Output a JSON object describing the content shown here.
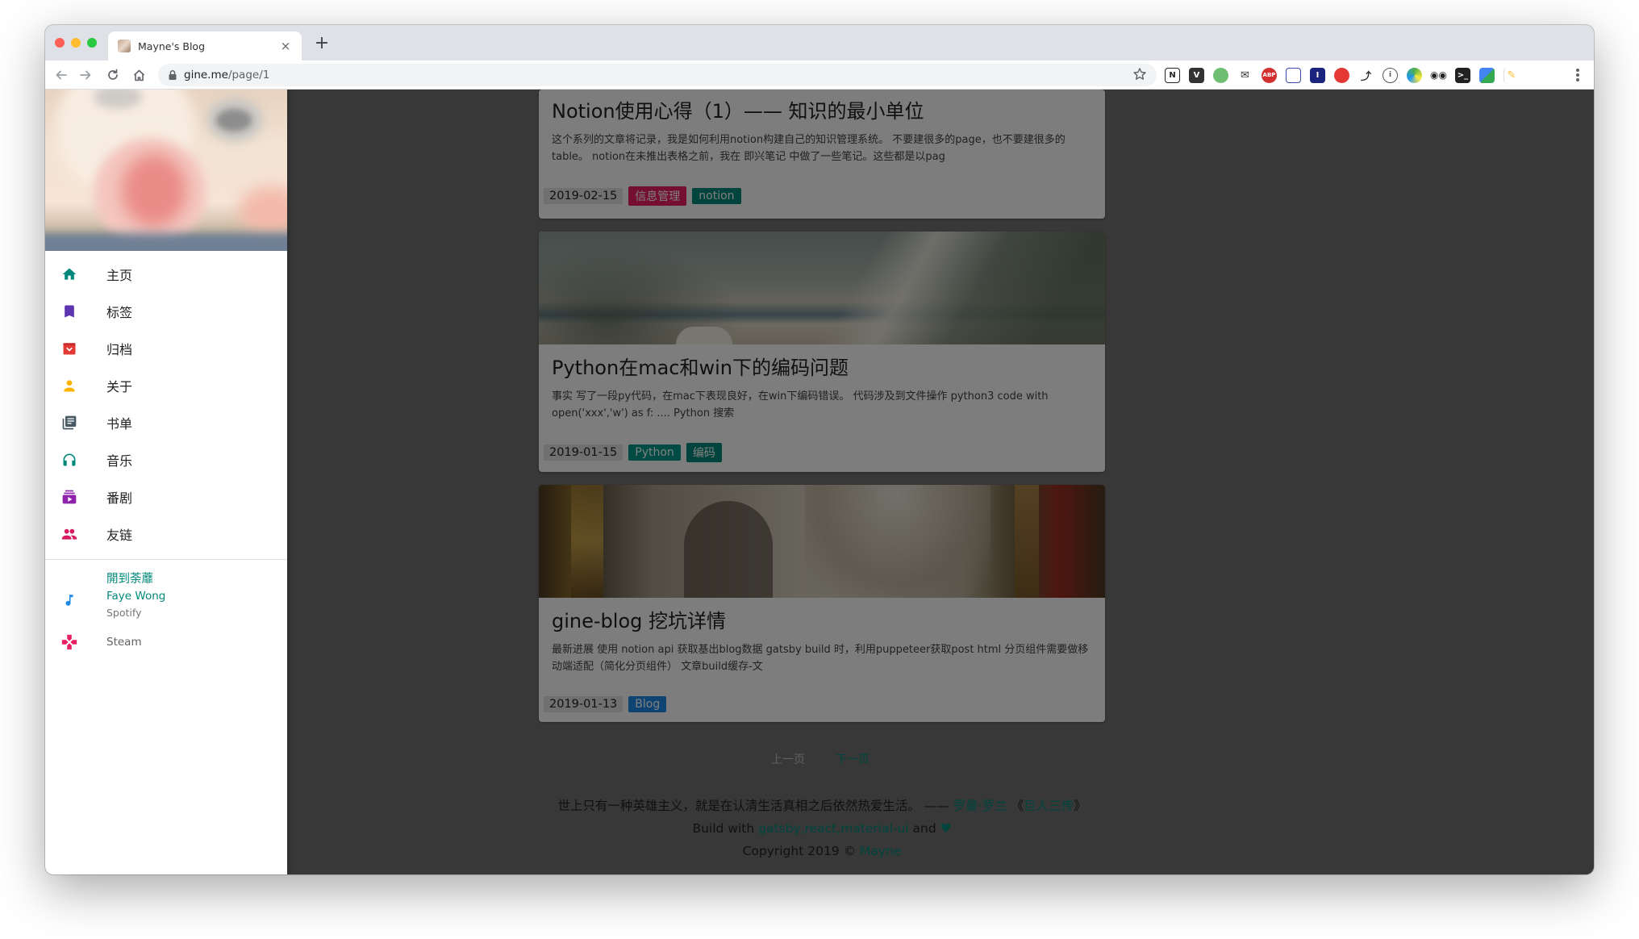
{
  "browser": {
    "tab_title": "Mayne's Blog",
    "tab_close": "×",
    "new_tab": "+",
    "url_host": "gine.me",
    "url_path": "/page/1"
  },
  "sidebar": {
    "items": [
      {
        "label": "主页",
        "icon": "home-icon",
        "color": "#00897b"
      },
      {
        "label": "标签",
        "icon": "bookmark-icon",
        "color": "#5e35b1"
      },
      {
        "label": "归档",
        "icon": "archive-icon",
        "color": "#e53935"
      },
      {
        "label": "关于",
        "icon": "person-icon",
        "color": "#ffb300"
      },
      {
        "label": "书单",
        "icon": "library-books-icon",
        "color": "#455a64"
      },
      {
        "label": "音乐",
        "icon": "headphones-icon",
        "color": "#00897b"
      },
      {
        "label": "番剧",
        "icon": "subscriptions-icon",
        "color": "#8e24aa"
      },
      {
        "label": "友链",
        "icon": "people-icon",
        "color": "#d81b60"
      }
    ],
    "music": {
      "title": "開到荼蘼",
      "artist": "Faye Wong",
      "source": "Spotify",
      "icon": "music-note-icon",
      "color": "#1e88e5"
    },
    "steam": {
      "label": "Steam",
      "icon": "gamepad-icon",
      "color": "#e91e63"
    }
  },
  "posts": [
    {
      "title": "Notion使用心得（1）—— 知识的最小单位",
      "excerpt": "这个系列的文章将记录，我是如何利用notion构建自己的知识管理系统。 不要建很多的page，也不要建很多的table。 notion在未推出表格之前，我在 即兴笔记 中做了一些笔记。这些都是以pag",
      "date": "2019-02-15",
      "tags": [
        {
          "name": "信息管理",
          "color": "#e91e63"
        },
        {
          "name": "notion",
          "color": "#00897b"
        }
      ]
    },
    {
      "title": "Python在mac和win下的编码问题",
      "excerpt": "事实 写了一段py代码，在mac下表现良好，在win下编码错误。 代码涉及到文件操作 python3 code with open('xxx','w') as f: .... Python 搜索",
      "date": "2019-01-15",
      "tags": [
        {
          "name": "Python",
          "color": "#009688"
        },
        {
          "name": "编码",
          "color": "#00897b"
        }
      ]
    },
    {
      "title": "gine-blog 挖坑详情",
      "excerpt": "最新进展 使用 notion api 获取基出blog数据 gatsby build 时，利用puppeteer获取post html 分页组件需要做移动端适配（简化分页组件） 文章build缓存-文",
      "date": "2019-01-13",
      "tags": [
        {
          "name": "Blog",
          "color": "#1e88e5"
        }
      ]
    }
  ],
  "pager": {
    "prev": "上一页",
    "next": "下一页"
  },
  "footer": {
    "quote": "世上只有一种英雄主义，就是在认清生活真相之后依然热爱生活。 —— ",
    "author": "罗曼·罗兰",
    "book_open": " 《",
    "book": "巨人三传",
    "book_close": "》",
    "build_prefix": "Build with ",
    "tech1": "gatsby",
    "sep1": ",",
    "tech2": "react",
    "sep2": ",",
    "tech3": "material-ui",
    "and": " and ",
    "heart": "♥",
    "copyright": "Copyright 2019 © ",
    "owner": "Mayne"
  }
}
